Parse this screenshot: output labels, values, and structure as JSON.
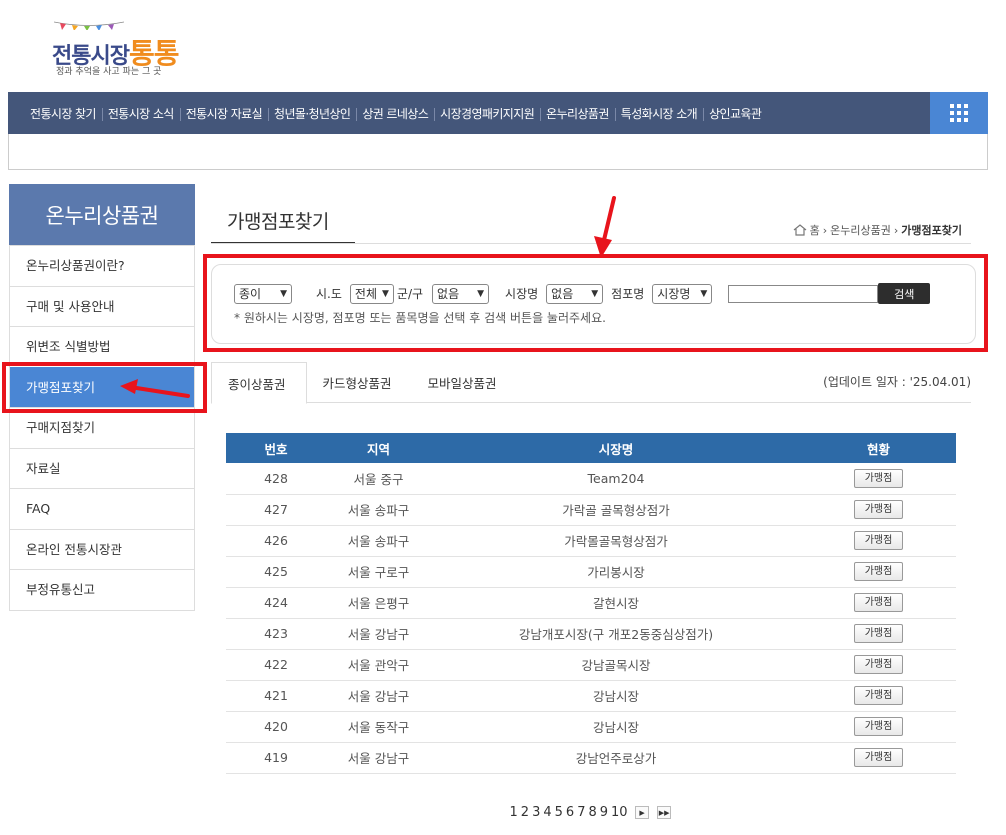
{
  "logo": {
    "title_a": "전통시장",
    "title_b": "통통",
    "tagline": "정과 추억을 사고 파는 그 곳"
  },
  "topnav": {
    "items": [
      "전통시장 찾기",
      "전통시장 소식",
      "전통시장 자료실",
      "청년몰·청년상인",
      "상권 르네상스",
      "시장경영패키지지원",
      "온누리상품권",
      "특성화시장 소개",
      "상인교육관"
    ]
  },
  "sidebar": {
    "heading": "온누리상품권",
    "items": [
      "온누리상품권이란?",
      "구매 및 사용안내",
      "위변조 식별방법",
      "가맹점포찾기",
      "구매지점찾기",
      "자료실",
      "FAQ",
      "온라인 전통시장관",
      "부정유통신고"
    ]
  },
  "page": {
    "title": "가맹점포찾기",
    "breadcrumb": {
      "home": "홈",
      "section": "온누리상품권",
      "current": "가맹점포찾기"
    }
  },
  "search": {
    "type_select": "종이",
    "sido_label": "시.도",
    "sido_select": "전체",
    "gungu_label": "군/구",
    "gungu_select": "없음",
    "market_label": "시장명",
    "market_select": "없음",
    "store_label": "점포명",
    "store_select": "시장명",
    "query_value": "",
    "button_label": "검색",
    "hint": "* 원하시는 시장명, 점포명 또는 품목명을 선택 후 검색 버튼을 눌러주세요."
  },
  "tabs": [
    "종이상품권",
    "카드형상품권",
    "모바일상품권"
  ],
  "update_note": "(업데이트 일자 : '25.04.01)",
  "table": {
    "headers": [
      "번호",
      "지역",
      "시장명",
      "현황"
    ],
    "rows": [
      {
        "no": "428",
        "region": "서울 중구",
        "market": "Team204",
        "status": "가맹점"
      },
      {
        "no": "427",
        "region": "서울 송파구",
        "market": "가락골 골목형상점가",
        "status": "가맹점"
      },
      {
        "no": "426",
        "region": "서울 송파구",
        "market": "가락몰골목형상점가",
        "status": "가맹점"
      },
      {
        "no": "425",
        "region": "서울 구로구",
        "market": "가리봉시장",
        "status": "가맹점"
      },
      {
        "no": "424",
        "region": "서울 은평구",
        "market": "갈현시장",
        "status": "가맹점"
      },
      {
        "no": "423",
        "region": "서울 강남구",
        "market": "강남개포시장(구 개포2동중심상점가)",
        "status": "가맹점"
      },
      {
        "no": "422",
        "region": "서울 관악구",
        "market": "강남골목시장",
        "status": "가맹점"
      },
      {
        "no": "421",
        "region": "서울 강남구",
        "market": "강남시장",
        "status": "가맹점"
      },
      {
        "no": "420",
        "region": "서울 동작구",
        "market": "강남시장",
        "status": "가맹점"
      },
      {
        "no": "419",
        "region": "서울 강남구",
        "market": "강남언주로상가",
        "status": "가맹점"
      }
    ]
  },
  "pagination": {
    "pages": [
      "1",
      "2",
      "3",
      "4",
      "5",
      "6",
      "7",
      "8",
      "9",
      "10"
    ],
    "next_icon": "play-next-icon",
    "last_icon": "fast-forward-icon"
  },
  "colors": {
    "nav_bg": "#44567a",
    "accent_blue": "#4a86d4",
    "table_header": "#2d6aa7",
    "sidebar_head": "#5b79ad",
    "annotation_red": "#e8141c"
  }
}
